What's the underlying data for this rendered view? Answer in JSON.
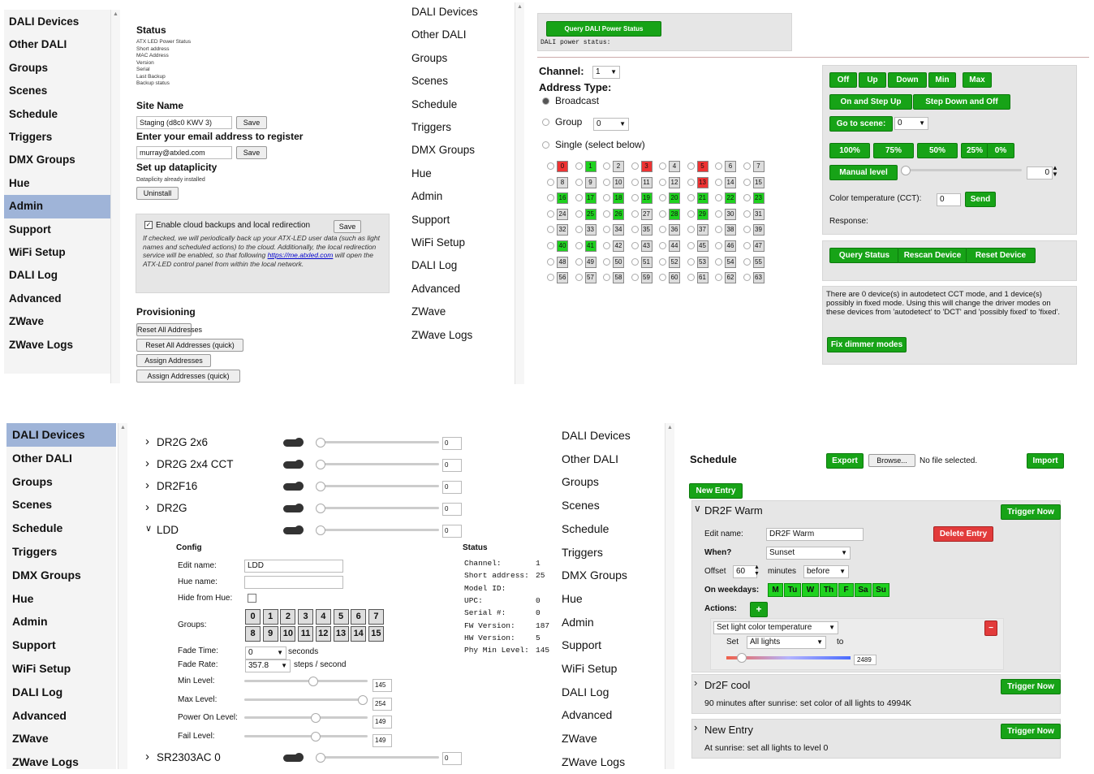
{
  "nav_top": [
    "DALI Devices",
    "Other DALI",
    "Groups",
    "Scenes",
    "Schedule",
    "Triggers",
    "DMX Groups",
    "Hue",
    "Admin",
    "Support",
    "WiFi Setup",
    "DALI Log",
    "Advanced",
    "ZWave",
    "ZWave Logs"
  ],
  "admin": {
    "status_title": "Status",
    "status_lines": [
      "ATX LED Power Status",
      "Short address",
      "MAC Address",
      "Version",
      "Serial",
      "Last Backup",
      "Backup status"
    ],
    "site_name_label": "Site Name",
    "site_name_value": "Staging (d8c0 KWV 3)",
    "save": "Save",
    "email_label": "Enter your email address to register",
    "email_value": "murray@atxled.com",
    "email_button": "Save",
    "dataplicity_label": "Set up dataplicity",
    "dataplicity_note": "Dataplicity already installed",
    "dataplicity_button": "Uninstall",
    "cloud_label": "Enable cloud backups and local redirection",
    "cloud_save": "Save",
    "cloud_note": "If checked, we will periodically back up your ATX-LED user data (such as light names and scheduled actions) to the cloud. Additionally, the local redirection service will be enabled, so that following",
    "cloud_link": "https://me.atxled.com",
    "cloud_note2": "will open the ATX-LED control panel from within the local network.",
    "prov_title": "Provisioning",
    "prov_buttons": [
      "Reset All Addresses",
      "Reset All Addresses (quick)",
      "Assign Addresses",
      "Assign Addresses (quick)"
    ]
  },
  "dali": {
    "query_button": "Query DALI Power Status",
    "power_status": "DALI power status:",
    "channel_label": "Channel:",
    "channel_value": "1",
    "address_type_label": "Address Type:",
    "broadcast": "Broadcast",
    "group": "Group",
    "group_value": "0",
    "single": "Single (select below)",
    "green": [
      1,
      16,
      17,
      18,
      19,
      20,
      21,
      22,
      23,
      25,
      26,
      28,
      29,
      40,
      41
    ],
    "red": [
      0,
      3,
      5,
      13
    ],
    "buttons_row1": [
      "Off",
      "Up",
      "Down",
      "Min",
      "Max"
    ],
    "buttons_row2": [
      "On and Step Up",
      "Step Down and Off"
    ],
    "goto_scene": "Go to scene:",
    "scene_value": "0",
    "percent": [
      "100%",
      "75%",
      "50%",
      "25%",
      "0%"
    ],
    "manual_level": "Manual level",
    "manual_value": "0",
    "color_temp_label": "Color temperature (CCT):",
    "color_temp_value": "0",
    "send": "Send",
    "response": "Response:",
    "query_buttons": [
      "Query Status",
      "Rescan Device",
      "Reset Device"
    ],
    "cct_note": "There are 0 device(s) in autodetect CCT mode, and 1 device(s) possibly in fixed mode. Using this will change the driver modes on these devices from 'autodetect' to 'DCT' and 'possibly fixed' to 'fixed'.",
    "fix_button": "Fix dimmer modes"
  },
  "devices": {
    "rows": [
      {
        "name": "DR2G 2x6",
        "level": "0"
      },
      {
        "name": "DR2G 2x4 CCT",
        "level": "0"
      },
      {
        "name": "DR2F16",
        "level": "0"
      },
      {
        "name": "DR2G",
        "level": "0"
      },
      {
        "name": "LDD",
        "level": "0"
      }
    ],
    "last_row": {
      "name": "SR2303AC 0",
      "level": "0"
    },
    "config_title": "Config",
    "edit_name_label": "Edit name:",
    "edit_name_value": "LDD",
    "hue_name_label": "Hue name:",
    "hide_hue_label": "Hide from Hue:",
    "groups_label": "Groups:",
    "fade_time_label": "Fade Time:",
    "fade_time_value": "0",
    "fade_time_unit": "seconds",
    "fade_rate_label": "Fade Rate:",
    "fade_rate_value": "357.8",
    "fade_rate_unit": "steps / second",
    "levels": [
      {
        "label": "Min Level:",
        "value": "145"
      },
      {
        "label": "Max Level:",
        "value": "254"
      },
      {
        "label": "Power On Level:",
        "value": "149"
      },
      {
        "label": "Fail Level:",
        "value": "149"
      }
    ],
    "status_title": "Status",
    "status": [
      {
        "k": "Channel:",
        "v": "1"
      },
      {
        "k": "Short address:",
        "v": "25"
      },
      {
        "k": "Model ID:",
        "v": ""
      },
      {
        "k": "UPC:",
        "v": "0"
      },
      {
        "k": "Serial #:",
        "v": "0"
      },
      {
        "k": "FW Version:",
        "v": "187"
      },
      {
        "k": "HW Version:",
        "v": "5"
      },
      {
        "k": "Phy Min Level:",
        "v": "145"
      }
    ]
  },
  "schedule": {
    "title": "Schedule",
    "export": "Export",
    "browse": "Browse...",
    "no_file": "No file selected.",
    "import": "Import",
    "new_entry": "New Entry",
    "entry1_title": "DR2F Warm",
    "trigger_now": "Trigger Now",
    "edit_name_label": "Edit name:",
    "edit_name_value": "DR2F Warm",
    "delete": "Delete Entry",
    "when_label": "When?",
    "when_value": "Sunset",
    "offset_label": "Offset",
    "offset_value": "60",
    "minutes": "minutes",
    "before": "before",
    "weekdays_label": "On weekdays:",
    "days": [
      "M",
      "Tu",
      "W",
      "Th",
      "F",
      "Sa",
      "Su"
    ],
    "actions_label": "Actions:",
    "action_value": "Set light color temperature",
    "set": "Set",
    "target": "All lights",
    "to": "to",
    "temp_value": "2489",
    "entry2_title": "Dr2F cool",
    "entry2_desc": "90 minutes after sunrise: set color of all lights to 4994K",
    "entry3_title": "New Entry",
    "entry3_desc": "At sunrise: set all lights to level 0"
  }
}
